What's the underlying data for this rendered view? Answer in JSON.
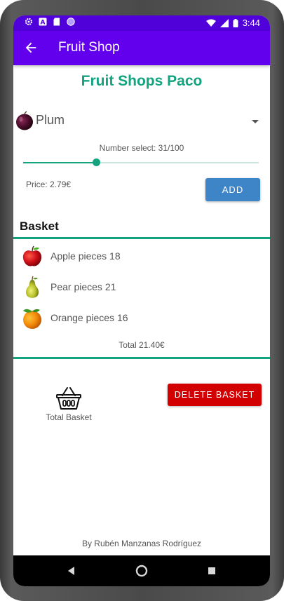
{
  "colors": {
    "status_bar": "#5000d8",
    "app_bar": "#6200ee",
    "accent_green": "#14a37f",
    "add_button": "#3d85c6",
    "delete_button": "#d20000"
  },
  "status_bar": {
    "time": "3:44",
    "left_icons": [
      "gear-icon",
      "a-notification-icon",
      "sd-card-icon",
      "circle-app-icon"
    ],
    "right_icons": [
      "wifi-icon",
      "signal-icon",
      "battery-icon"
    ]
  },
  "app_bar": {
    "back_icon": "arrow-back-icon",
    "title": "Fruit Shop"
  },
  "shop": {
    "title": "Fruit Shops Paco"
  },
  "spinner": {
    "selected": "Plum",
    "icon": "plum-icon"
  },
  "quantity": {
    "label": "Number select: 31/100",
    "value": 31,
    "max": 100
  },
  "price": {
    "label": "Price: 2.79€"
  },
  "buttons": {
    "add": "ADD",
    "delete_basket": "DELETE BASKET"
  },
  "basket": {
    "title": "Basket",
    "items": [
      {
        "icon": "apple-icon",
        "text": "Apple pieces 18"
      },
      {
        "icon": "pear-icon",
        "text": "Pear pieces 21"
      },
      {
        "icon": "orange-icon",
        "text": "Orange pieces 16"
      }
    ],
    "total": "Total 21.40€"
  },
  "total_basket": {
    "icon": "basket-icon",
    "label": "Total Basket"
  },
  "footer": {
    "credit": "By Rubén Manzanas Rodríguez"
  },
  "nav_bar": {
    "icons": [
      "nav-back-icon",
      "nav-home-icon",
      "nav-recents-icon"
    ]
  }
}
